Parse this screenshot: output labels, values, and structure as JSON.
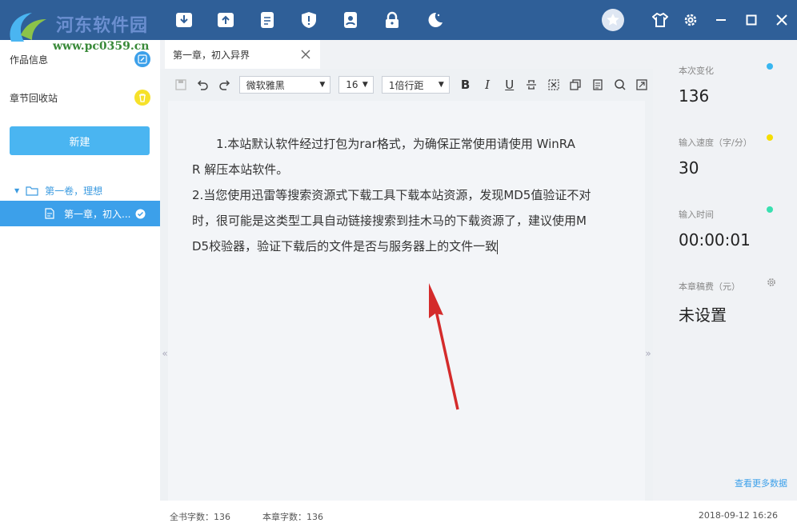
{
  "logo": {
    "brand": "河东软件园",
    "url": "www.pc0359.cn"
  },
  "topbar": {
    "icons": [
      "download-icon",
      "upload-icon",
      "notes-icon",
      "shield-icon",
      "contacts-icon",
      "lock-icon",
      "night-mode-icon"
    ],
    "right_icons": [
      "avatar-icon",
      "shirt-icon",
      "settings-icon",
      "minimize-icon",
      "maximize-icon",
      "close-icon"
    ]
  },
  "sidebar": {
    "work_info": "作品信息",
    "recycle": "章节回收站",
    "new_button": "新建",
    "volume": "第一卷，理想",
    "chapter": "第一章，初入..."
  },
  "tab": {
    "title": "第一章，初入异界"
  },
  "toolbar": {
    "font": "微软雅黑",
    "size": "16",
    "line_spacing": "1倍行距"
  },
  "editor": {
    "lines": [
      "1.本站默认软件经过打包为rar格式，为确保正常使用请使用 WinRA",
      "R 解压本站软件。",
      "2.当您使用迅雷等搜索资源式下载工具下载本站资源，发现MD5值验证不对",
      "时，很可能是这类型工具自动链接搜索到挂木马的下载资源了，建议使用M",
      "D5校验器，验证下载后的文件是否与服务器上的文件一致"
    ],
    "left_edge": "«",
    "right_edge": "»"
  },
  "stats": {
    "change_label": "本次变化",
    "change_value": "136",
    "speed_label": "输入速度（字/分）",
    "speed_value": "30",
    "time_label": "输入时间",
    "time_value": "00:00:01",
    "fee_label": "本章稿费（元）",
    "fee_value": "未设置",
    "more": "查看更多数据",
    "colors": {
      "change": "#38b6f0",
      "speed": "#f5dd00",
      "time": "#39e0b0"
    }
  },
  "statusbar": {
    "book_count": "全书字数：136",
    "chapter_count": "本章字数：136",
    "datetime": "2018-09-12 16:26"
  }
}
